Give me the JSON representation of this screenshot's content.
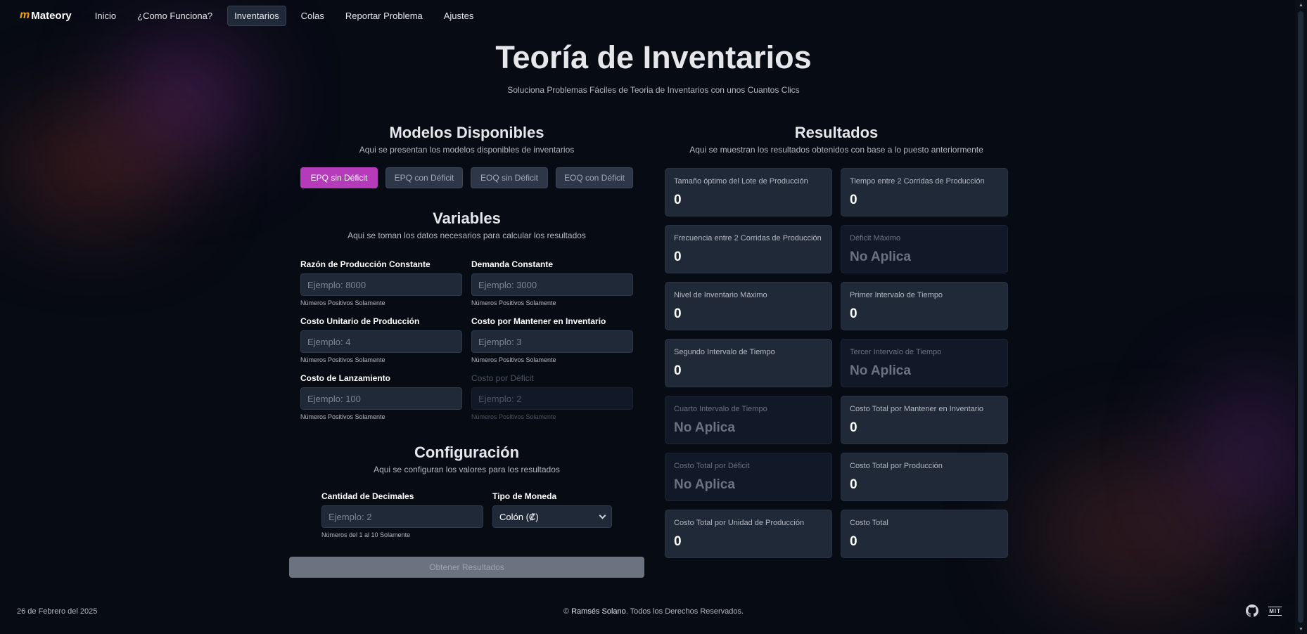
{
  "brand": {
    "name": "Mateory",
    "mark": "m"
  },
  "nav": [
    "Inicio",
    "¿Como Funciona?",
    "Inventarios",
    "Colas",
    "Reportar Problema",
    "Ajustes"
  ],
  "active_nav": "Inventarios",
  "header": {
    "title": "Teoría de Inventarios",
    "subtitle": "Soluciona Problemas Fáciles de Teoria de Inventarios con unos Cuantos Clics"
  },
  "models": {
    "title": "Modelos Disponibles",
    "subtitle": "Aqui se presentan los modelos disponibles de inventarios",
    "items": [
      "EPQ sin Déficit",
      "EPQ con Déficit",
      "EOQ sin Déficit",
      "EOQ con Déficit"
    ],
    "active": "EPQ sin Déficit",
    "accent_color": "#b53bbb"
  },
  "variables": {
    "title": "Variables",
    "subtitle": "Aqui se toman los datos necesarios para calcular los resultados",
    "fields": [
      {
        "label": "Razón de Producción Constante",
        "placeholder": "Ejemplo: 8000",
        "help": "Números Positivos Solamente",
        "disabled": false
      },
      {
        "label": "Demanda Constante",
        "placeholder": "Ejemplo: 3000",
        "help": "Números Positivos Solamente",
        "disabled": false
      },
      {
        "label": "Costo Unitario de Producción",
        "placeholder": "Ejemplo: 4",
        "help": "Números Positivos Solamente",
        "disabled": false
      },
      {
        "label": "Costo por Mantener en Inventario",
        "placeholder": "Ejemplo: 3",
        "help": "Números Positivos Solamente",
        "disabled": false
      },
      {
        "label": "Costo de Lanzamiento",
        "placeholder": "Ejemplo: 100",
        "help": "Números Positivos Solamente",
        "disabled": false
      },
      {
        "label": "Costo por Déficit",
        "placeholder": "Ejemplo: 2",
        "help": "Números Positivos Solamente",
        "disabled": true
      }
    ]
  },
  "config": {
    "title": "Configuración",
    "subtitle": "Aqui se configuran los valores para los resultados",
    "decimals": {
      "label": "Cantidad de Decimales",
      "placeholder": "Ejemplo: 2",
      "help": "Números del 1 al 10 Solamente"
    },
    "currency": {
      "label": "Tipo de Moneda",
      "value": "Colón (₡)"
    }
  },
  "submit_label": "Obtener Resultados",
  "results": {
    "title": "Resultados",
    "subtitle": "Aqui se muestran los resultados obtenidos con base a lo puesto anteriormente",
    "cards": [
      {
        "label": "Tamaño óptimo del Lote de Producción",
        "value": "0",
        "na": false
      },
      {
        "label": "Tiempo entre 2 Corridas de Producción",
        "value": "0",
        "na": false
      },
      {
        "label": "Frecuencia entre 2 Corridas de Producción",
        "value": "0",
        "na": false
      },
      {
        "label": "Déficit Máximo",
        "value": "No Aplica",
        "na": true
      },
      {
        "label": "Nivel de Inventario Máximo",
        "value": "0",
        "na": false
      },
      {
        "label": "Primer Intervalo de Tiempo",
        "value": "0",
        "na": false
      },
      {
        "label": "Segundo Intervalo de Tiempo",
        "value": "0",
        "na": false
      },
      {
        "label": "Tercer Intervalo de Tiempo",
        "value": "No Aplica",
        "na": true
      },
      {
        "label": "Cuarto Intervalo de Tiempo",
        "value": "No Aplica",
        "na": true
      },
      {
        "label": "Costo Total por Mantener en Inventario",
        "value": "0",
        "na": false
      },
      {
        "label": "Costo Total por Déficit",
        "value": "No Aplica",
        "na": true
      },
      {
        "label": "Costo Total por Producción",
        "value": "0",
        "na": false
      },
      {
        "label": "Costo Total por Unidad de Producción",
        "value": "0",
        "na": false
      },
      {
        "label": "Costo Total",
        "value": "0",
        "na": false
      }
    ]
  },
  "footer": {
    "date": "26 de Febrero del 2025",
    "copyright_symbol": "©",
    "author": "Ramsés Solano",
    "rights": ". Todos los Derechos Reservados.",
    "license_label": "MIT",
    "icons": [
      "github-icon",
      "mit-license-icon"
    ]
  }
}
